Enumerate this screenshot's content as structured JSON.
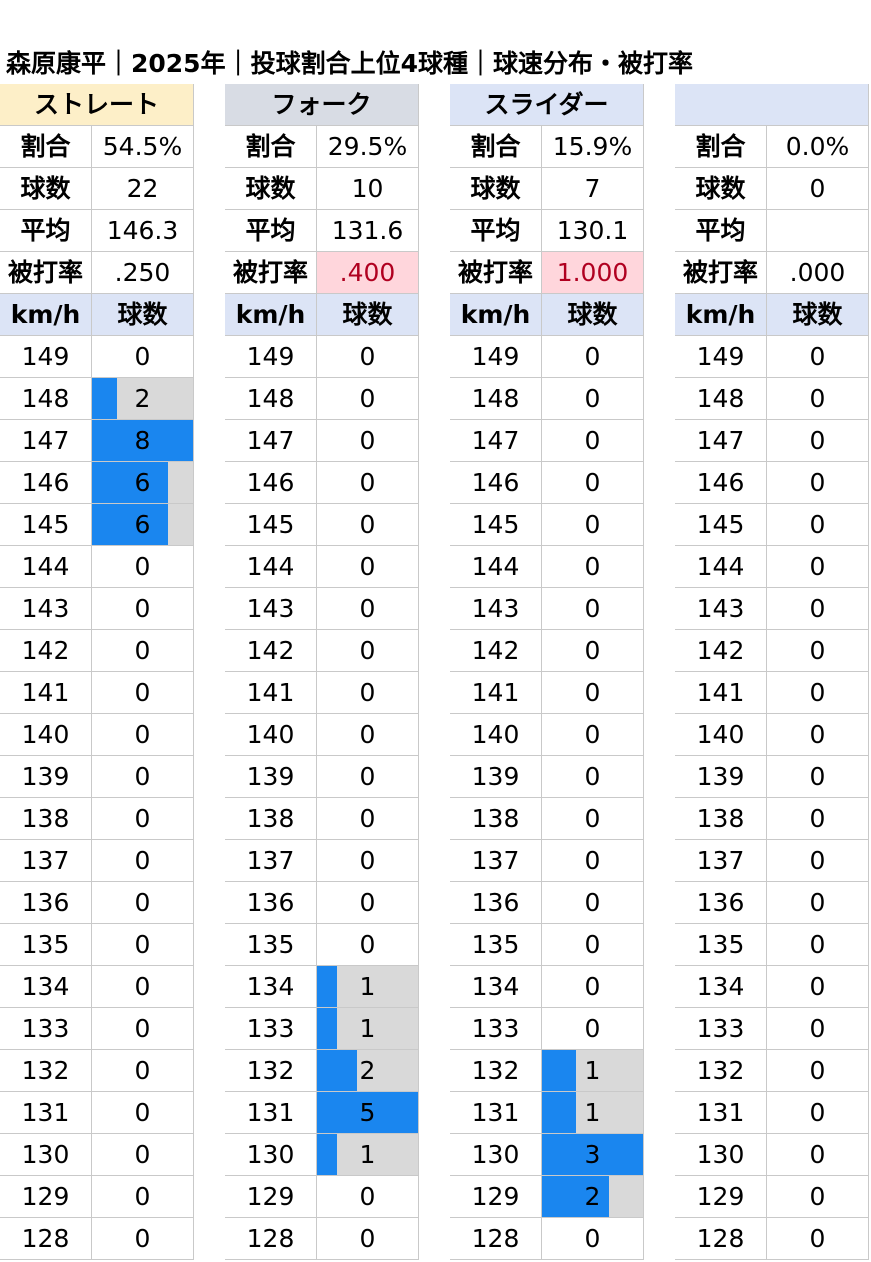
{
  "title": "森原康平｜2025年｜投球割合上位4球種｜球速分布・被打率",
  "labels": {
    "ratio": "割合",
    "count": "球数",
    "avg": "平均",
    "ba": "被打率",
    "kmh": "km/h",
    "col_count": "球数"
  },
  "speeds": [
    "149",
    "148",
    "147",
    "146",
    "145",
    "144",
    "143",
    "142",
    "141",
    "140",
    "139",
    "138",
    "137",
    "136",
    "135",
    "134",
    "133",
    "132",
    "131",
    "130",
    "129",
    "128"
  ],
  "colors": {
    "bar": "#1a86ef",
    "bar_bg": "#d9d9d9",
    "highlight_bg": "#ffd6dc",
    "highlight_text": "#b00020"
  },
  "pitches": [
    {
      "name": "ストレート",
      "header_color": "#fdefc8",
      "ratio": "54.5%",
      "count": "22",
      "avg": "146.3",
      "ba": ".250",
      "ba_highlight": false,
      "max": 8,
      "counts": [
        "0",
        "2",
        "8",
        "6",
        "6",
        "0",
        "0",
        "0",
        "0",
        "0",
        "0",
        "0",
        "0",
        "0",
        "0",
        "0",
        "0",
        "0",
        "0",
        "0",
        "0",
        "0"
      ]
    },
    {
      "name": "フォーク",
      "header_color": "#d8dce4",
      "ratio": "29.5%",
      "count": "10",
      "avg": "131.6",
      "ba": ".400",
      "ba_highlight": true,
      "max": 5,
      "counts": [
        "0",
        "0",
        "0",
        "0",
        "0",
        "0",
        "0",
        "0",
        "0",
        "0",
        "0",
        "0",
        "0",
        "0",
        "0",
        "1",
        "1",
        "2",
        "5",
        "1",
        "0",
        "0"
      ]
    },
    {
      "name": "スライダー",
      "header_color": "#dce4f6",
      "ratio": "15.9%",
      "count": "7",
      "avg": "130.1",
      "ba": "1.000",
      "ba_highlight": true,
      "max": 3,
      "counts": [
        "0",
        "0",
        "0",
        "0",
        "0",
        "0",
        "0",
        "0",
        "0",
        "0",
        "0",
        "0",
        "0",
        "0",
        "0",
        "0",
        "0",
        "1",
        "1",
        "3",
        "2",
        "0"
      ]
    },
    {
      "name": "",
      "header_color": "#dce4f6",
      "ratio": "0.0%",
      "count": "0",
      "avg": "",
      "ba": ".000",
      "ba_highlight": false,
      "max": 0,
      "counts": [
        "0",
        "0",
        "0",
        "0",
        "0",
        "0",
        "0",
        "0",
        "0",
        "0",
        "0",
        "0",
        "0",
        "0",
        "0",
        "0",
        "0",
        "0",
        "0",
        "0",
        "0",
        "0"
      ]
    }
  ]
}
